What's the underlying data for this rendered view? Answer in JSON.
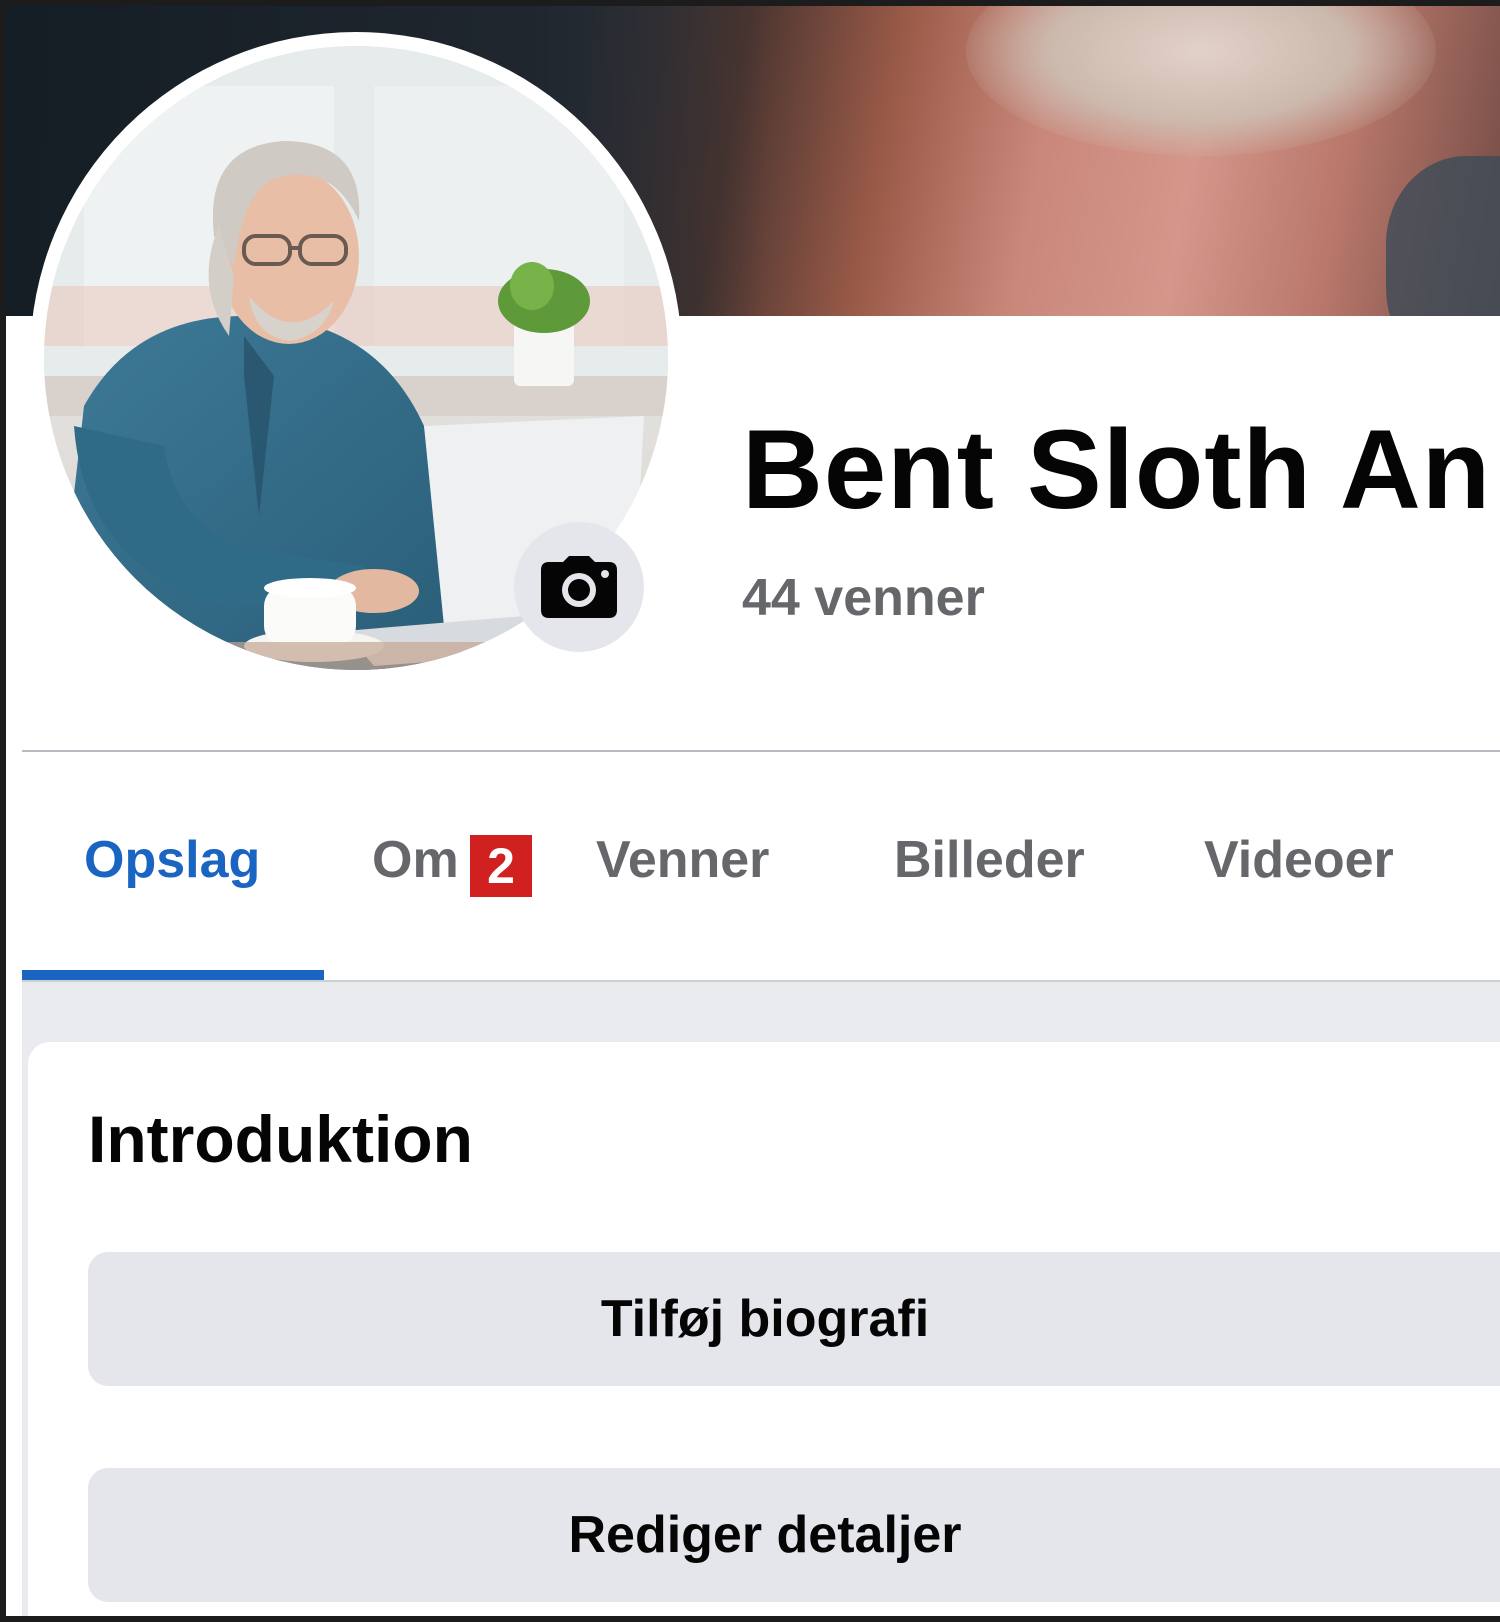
{
  "profile": {
    "name": "Bent Sloth An",
    "friends_count": "44 venner"
  },
  "tabs": [
    {
      "label": "Opslag",
      "active": true
    },
    {
      "label": "Om",
      "active": false
    },
    {
      "label": "Venner",
      "active": false
    },
    {
      "label": "Billeder",
      "active": false
    },
    {
      "label": "Videoer",
      "active": false
    }
  ],
  "callout_badge": "2",
  "intro": {
    "title": "Introduktion",
    "add_bio_label": "Tilføj biografi",
    "edit_details_label": "Rediger detaljer"
  },
  "colors": {
    "accent": "#1b65c2",
    "badge": "#d0201f",
    "button_bg": "#e4e6eb",
    "secondary_text": "#65676b"
  },
  "icons": {
    "camera": "camera-icon"
  }
}
